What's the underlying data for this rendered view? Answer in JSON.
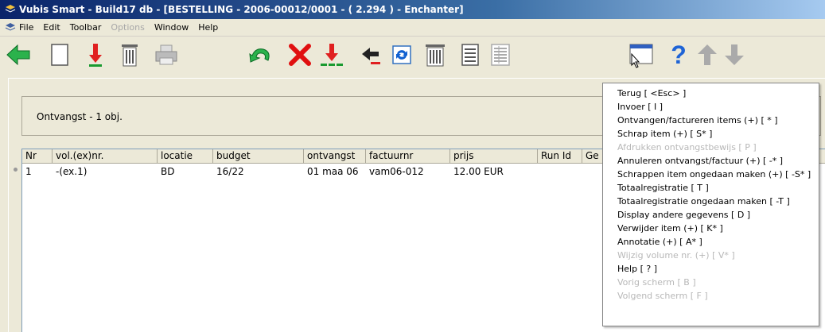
{
  "window": {
    "title": "Vubis Smart - Build17 db - [BESTELLING - 2006-00012/0001 - ( 2.294 ) - Enchanter]"
  },
  "menubar": {
    "items": [
      {
        "label": "File",
        "disabled": false
      },
      {
        "label": "Edit",
        "disabled": false
      },
      {
        "label": "Toolbar",
        "disabled": false
      },
      {
        "label": "Options",
        "disabled": true
      },
      {
        "label": "Window",
        "disabled": false
      },
      {
        "label": "Help",
        "disabled": false
      }
    ]
  },
  "toolbar": {
    "icons": [
      "back-arrow-icon",
      "new-page-icon",
      "download-icon",
      "trash-icon",
      "print-icon",
      "undo-icon",
      "delete-x-icon",
      "double-download-icon",
      "back-red-icon",
      "refresh-icon",
      "trash-icon-2",
      "list-icon",
      "grid-list-icon",
      "window-cursor-icon",
      "help-icon",
      "up-arrow-icon",
      "down-arrow-icon"
    ]
  },
  "header": {
    "label": "Ontvangst  - 1 obj."
  },
  "table": {
    "columns": [
      "Nr",
      "vol.(ex)nr.",
      "locatie",
      "budget",
      "ontvangst",
      "factuurnr",
      "prijs",
      "Run Id",
      "Ge"
    ],
    "rows": [
      [
        "1",
        "-(ex.1)",
        "BD",
        "16/22",
        "01 maa 06",
        "vam06-012",
        "12.00 EUR",
        "",
        ""
      ]
    ]
  },
  "popup_menu": {
    "items": [
      {
        "label": "Terug [ <Esc> ]",
        "disabled": false
      },
      {
        "label": "Invoer [ I ]",
        "disabled": false
      },
      {
        "label": "Ontvangen/factureren items (+) [ * ]",
        "disabled": false
      },
      {
        "label": "Schrap item (+) [ S* ]",
        "disabled": false
      },
      {
        "label": "Afdrukken ontvangstbewijs [ P ]",
        "disabled": true
      },
      {
        "label": "Annuleren ontvangst/factuur (+) [ -* ]",
        "disabled": false
      },
      {
        "label": "Schrappen item ongedaan maken (+) [ -S* ]",
        "disabled": false
      },
      {
        "label": "Totaalregistratie [ T ]",
        "disabled": false
      },
      {
        "label": "Totaalregistratie ongedaan maken [ -T ]",
        "disabled": false
      },
      {
        "label": "Display andere gegevens [ D ]",
        "disabled": false
      },
      {
        "label": "Verwijder item (+) [ K* ]",
        "disabled": false
      },
      {
        "label": "Annotatie (+) [ A* ]",
        "disabled": false
      },
      {
        "label": "Wijzig volume nr. (+) [ V* ]",
        "disabled": true
      },
      {
        "label": "Help [ ? ]",
        "disabled": false
      },
      {
        "label": "Vorig scherm [ B ]",
        "disabled": true
      },
      {
        "label": "Volgend scherm [ F ]",
        "disabled": true
      }
    ]
  }
}
